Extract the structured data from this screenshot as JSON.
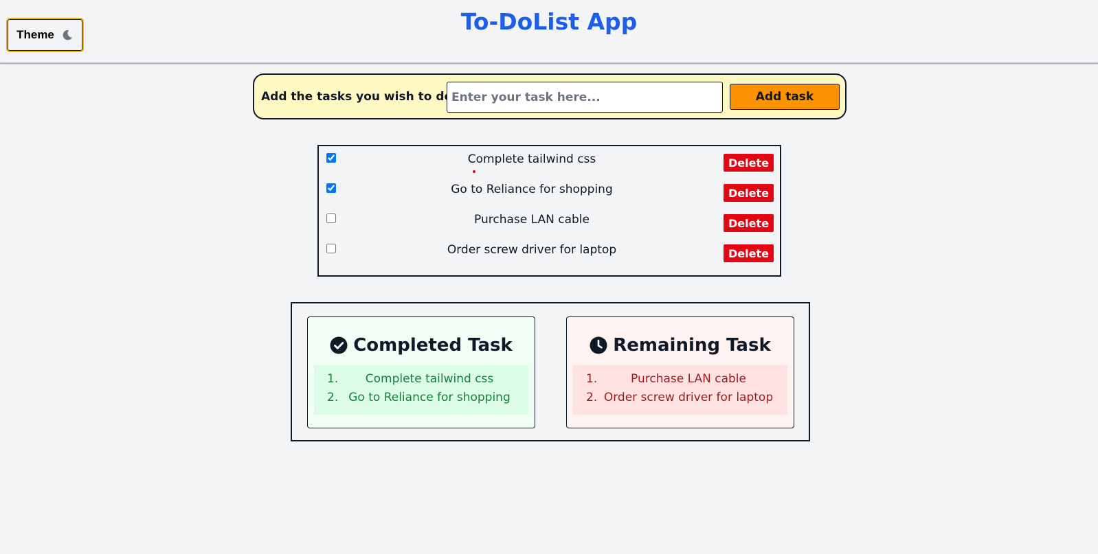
{
  "header": {
    "theme_label": "Theme",
    "title": "To-DoList App"
  },
  "add_bar": {
    "label": "Add the tasks you wish to do :",
    "input_placeholder": "Enter your task here...",
    "input_value": "",
    "button_label": "Add task"
  },
  "tasks": [
    {
      "text": "Complete tailwind css",
      "checked": true,
      "delete_label": "Delete"
    },
    {
      "text": "Go to Reliance for shopping",
      "checked": true,
      "delete_label": "Delete"
    },
    {
      "text": "Purchase LAN cable",
      "checked": false,
      "delete_label": "Delete"
    },
    {
      "text": "Order screw driver for laptop",
      "checked": false,
      "delete_label": "Delete"
    }
  ],
  "completed": {
    "title": "Completed Task",
    "icon": "check-circle-icon",
    "items": [
      {
        "num": "1.",
        "text": "Complete tailwind css"
      },
      {
        "num": "2.",
        "text": "Go to Reliance for shopping"
      }
    ]
  },
  "remaining": {
    "title": "Remaining Task",
    "icon": "clock-icon",
    "items": [
      {
        "num": "1.",
        "text": "Purchase LAN cable"
      },
      {
        "num": "2.",
        "text": "Order screw driver for laptop"
      }
    ]
  },
  "colors": {
    "title": "#1d5fe8",
    "add_button": "#fb9200",
    "delete_button": "#e30613",
    "add_bar_bg": "#fef9c3",
    "completed_text": "#15803d",
    "remaining_text": "#991b1b"
  }
}
